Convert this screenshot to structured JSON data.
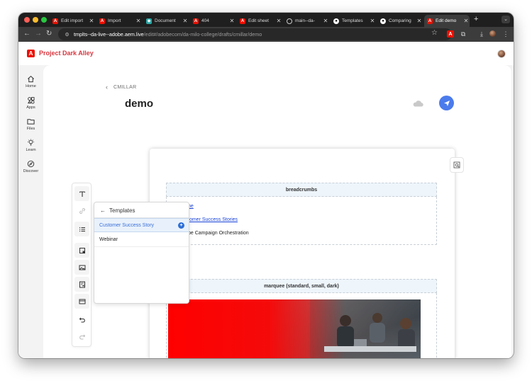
{
  "browser": {
    "tabs": [
      {
        "title": "Edit import",
        "favicon": "adobe-icon",
        "active": false
      },
      {
        "title": "Import",
        "favicon": "adobe-icon",
        "active": false
      },
      {
        "title": "Document",
        "favicon": "da-icon",
        "active": false
      },
      {
        "title": "404",
        "favicon": "adobe-icon",
        "active": false
      },
      {
        "title": "Edit sheet",
        "favicon": "adobe-icon",
        "active": false
      },
      {
        "title": "main--da-",
        "favicon": "globe-icon",
        "active": false
      },
      {
        "title": "Templates",
        "favicon": "github-icon",
        "active": false
      },
      {
        "title": "Comparing",
        "favicon": "github-icon",
        "active": false
      },
      {
        "title": "Edit demo",
        "favicon": "adobe-icon",
        "active": true
      }
    ],
    "url_host": "tmplts--da-live--adobe.aem.live",
    "url_path": "/edit#/adobecom/da-milo-college/drafts/cmillar/demo"
  },
  "app": {
    "name": "Project Dark Alley",
    "brand_color": "#d7373f"
  },
  "leftnav": {
    "items": [
      {
        "label": "Home",
        "icon": "home-icon"
      },
      {
        "label": "Apps",
        "icon": "apps-icon"
      },
      {
        "label": "Files",
        "icon": "folder-icon"
      },
      {
        "label": "Learn",
        "icon": "lightbulb-icon"
      },
      {
        "label": "Discover",
        "icon": "compass-icon"
      }
    ]
  },
  "editor": {
    "breadcrumb": "CMILLAR",
    "doc_title": "demo",
    "accent_color": "#4b7bec"
  },
  "templates_panel": {
    "title": "Templates",
    "items": [
      {
        "label": "Customer Success Story",
        "selected": true
      },
      {
        "label": "Webinar",
        "selected": false
      }
    ]
  },
  "document": {
    "blocks": [
      {
        "name": "breadcrumbs",
        "lines": [
          "ne",
          "tomer Success Stories",
          "be Campaign Orchestration"
        ]
      },
      {
        "name": "marquee (standard, small, dark)"
      }
    ]
  }
}
